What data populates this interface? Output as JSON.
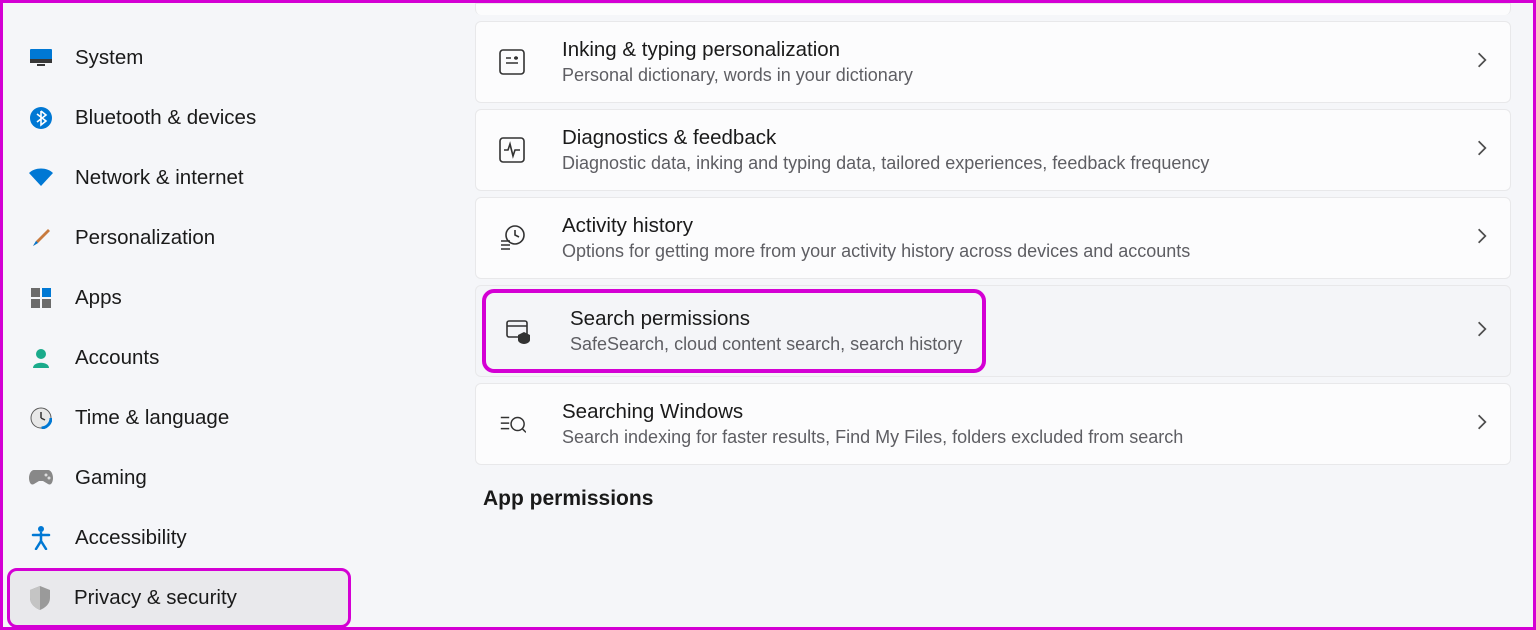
{
  "sidebar": {
    "items": [
      {
        "label": "System"
      },
      {
        "label": "Bluetooth & devices"
      },
      {
        "label": "Network & internet"
      },
      {
        "label": "Personalization"
      },
      {
        "label": "Apps"
      },
      {
        "label": "Accounts"
      },
      {
        "label": "Time & language"
      },
      {
        "label": "Gaming"
      },
      {
        "label": "Accessibility"
      },
      {
        "label": "Privacy & security"
      }
    ]
  },
  "main": {
    "cards": [
      {
        "title": "Inking & typing personalization",
        "desc": "Personal dictionary, words in your dictionary"
      },
      {
        "title": "Diagnostics & feedback",
        "desc": "Diagnostic data, inking and typing data, tailored experiences, feedback frequency"
      },
      {
        "title": "Activity history",
        "desc": "Options for getting more from your activity history across devices and accounts"
      },
      {
        "title": "Search permissions",
        "desc": "SafeSearch, cloud content search, search history"
      },
      {
        "title": "Searching Windows",
        "desc": "Search indexing for faster results, Find My Files, folders excluded from search"
      }
    ],
    "section_heading": "App permissions"
  }
}
